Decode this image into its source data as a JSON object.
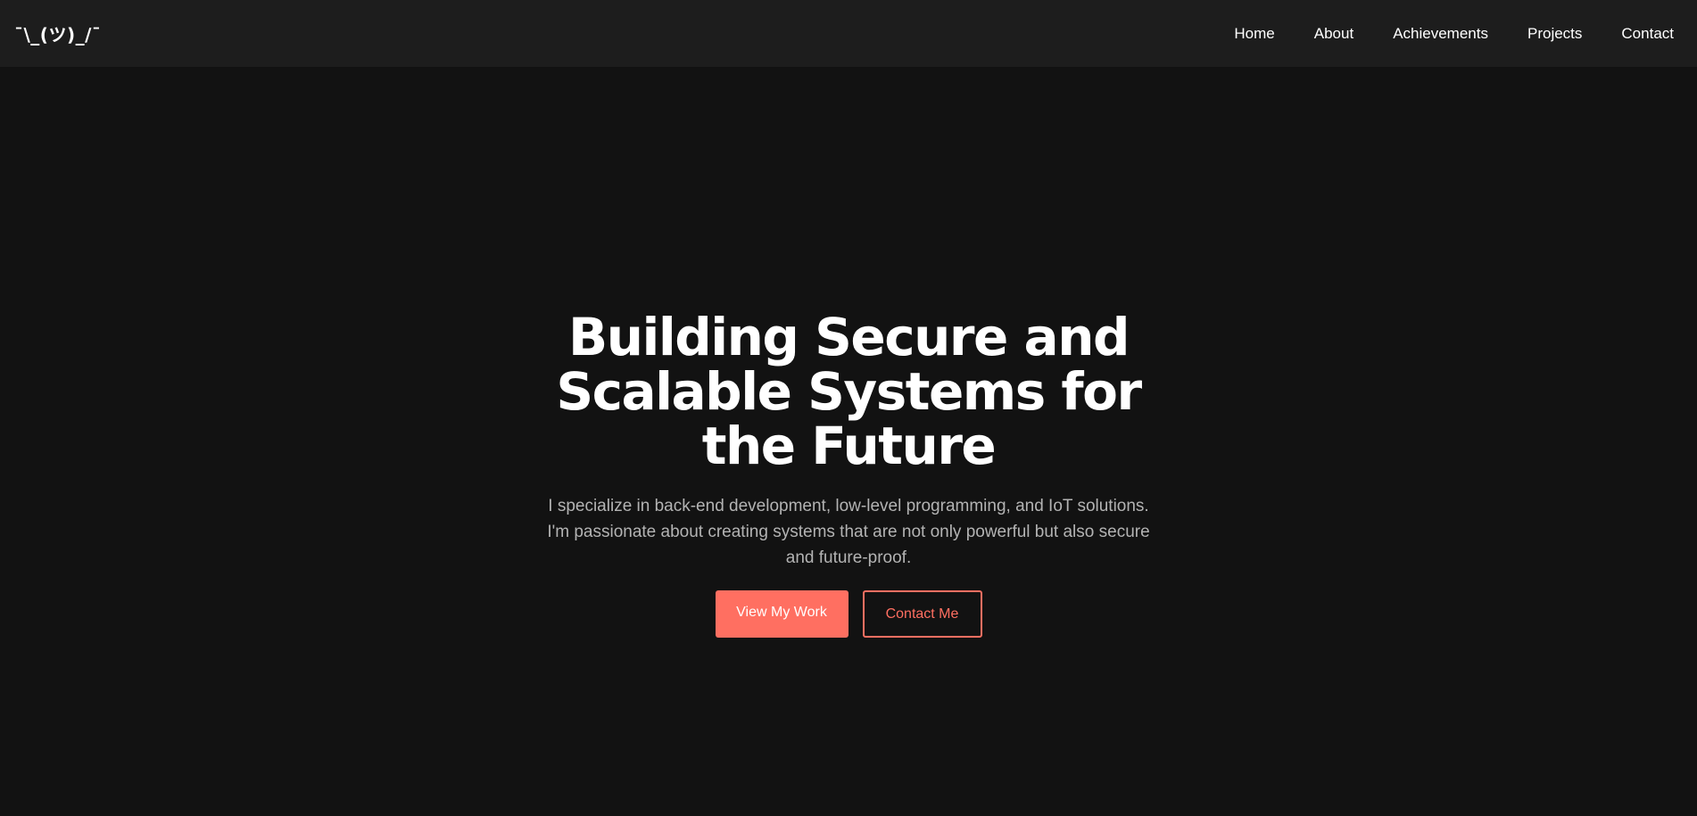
{
  "nav": {
    "logo": "¯\\_(ツ)_/¯",
    "links": [
      {
        "label": "Home"
      },
      {
        "label": "About"
      },
      {
        "label": "Achievements"
      },
      {
        "label": "Projects"
      },
      {
        "label": "Contact"
      }
    ]
  },
  "hero": {
    "title": "Building Secure and Scalable Systems for the Future",
    "description": "I specialize in back-end development, low-level programming, and IoT solutions. I'm passionate about creating systems that are not only powerful but also secure and future-proof.",
    "primary_button": "View My Work",
    "secondary_button": "Contact Me"
  },
  "colors": {
    "accent": "#ff6f61",
    "background": "#121212",
    "navbar": "#1d1d1d",
    "text_muted": "#b3b3b3"
  }
}
